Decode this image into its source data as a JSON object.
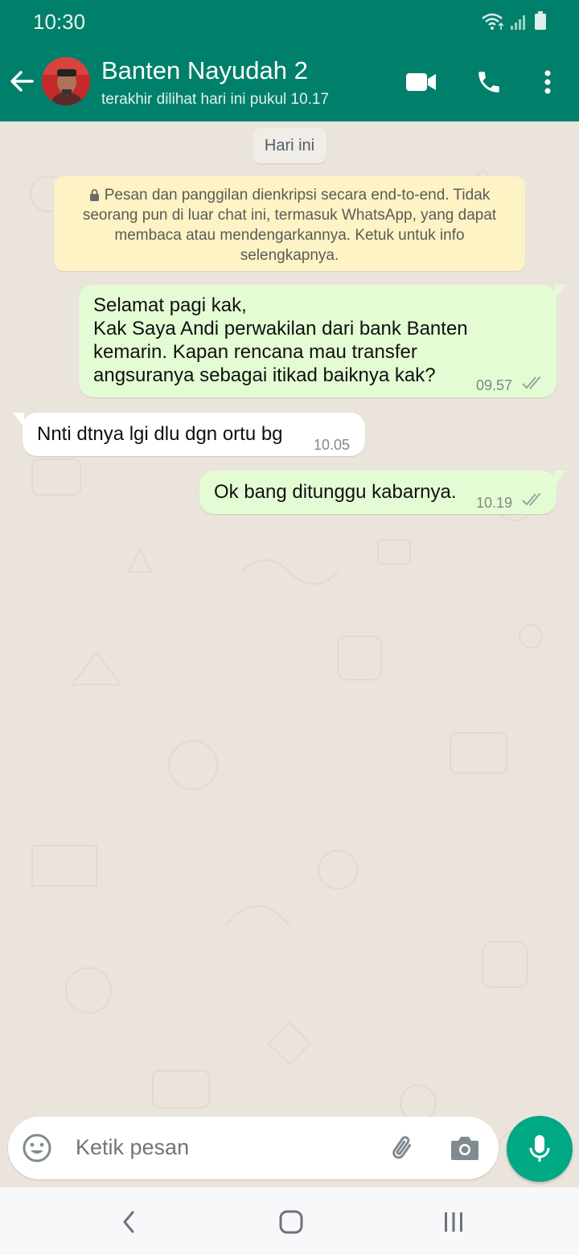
{
  "status_bar": {
    "time": "10:30"
  },
  "header": {
    "contact_name": "Banten Nayudah 2",
    "last_seen": "terakhir dilihat hari ini pukul 10.17",
    "icons": [
      "back-arrow-icon",
      "video-call-icon",
      "voice-call-icon",
      "more-options-icon"
    ]
  },
  "chat": {
    "date_chip": "Hari ini",
    "encryption_notice": "Pesan dan panggilan dienkripsi secara end-to-end. Tidak seorang pun di luar chat ini, termasuk WhatsApp, yang dapat membaca atau mendengarkannya. Ketuk untuk info selengkapnya.",
    "messages": [
      {
        "direction": "outgoing",
        "lines": [
          "Selamat pagi kak,",
          "Kak Saya Andi perwakilan dari bank Banten",
          "kemarin. Kapan rencana mau transfer",
          "angsuranya sebagai itikad baiknya kak?"
        ],
        "time": "09.57",
        "status": "read"
      },
      {
        "direction": "incoming",
        "lines": [
          "Nnti dtnya lgi dlu dgn ortu bg"
        ],
        "time": "10.05"
      },
      {
        "direction": "outgoing",
        "lines": [
          "Ok bang ditunggu kabarnya."
        ],
        "time": "10.19",
        "status": "read"
      }
    ]
  },
  "composer": {
    "placeholder": "Ketik pesan",
    "icons": [
      "emoji-icon",
      "attach-icon",
      "camera-icon",
      "mic-icon"
    ]
  },
  "colors": {
    "header": "#00806a",
    "outgoing_bubble": "#e4fcd4",
    "incoming_bubble": "#ffffff",
    "notice": "#fdf3c5",
    "mic_button": "#00a884",
    "chat_background": "#ebe4dc"
  }
}
